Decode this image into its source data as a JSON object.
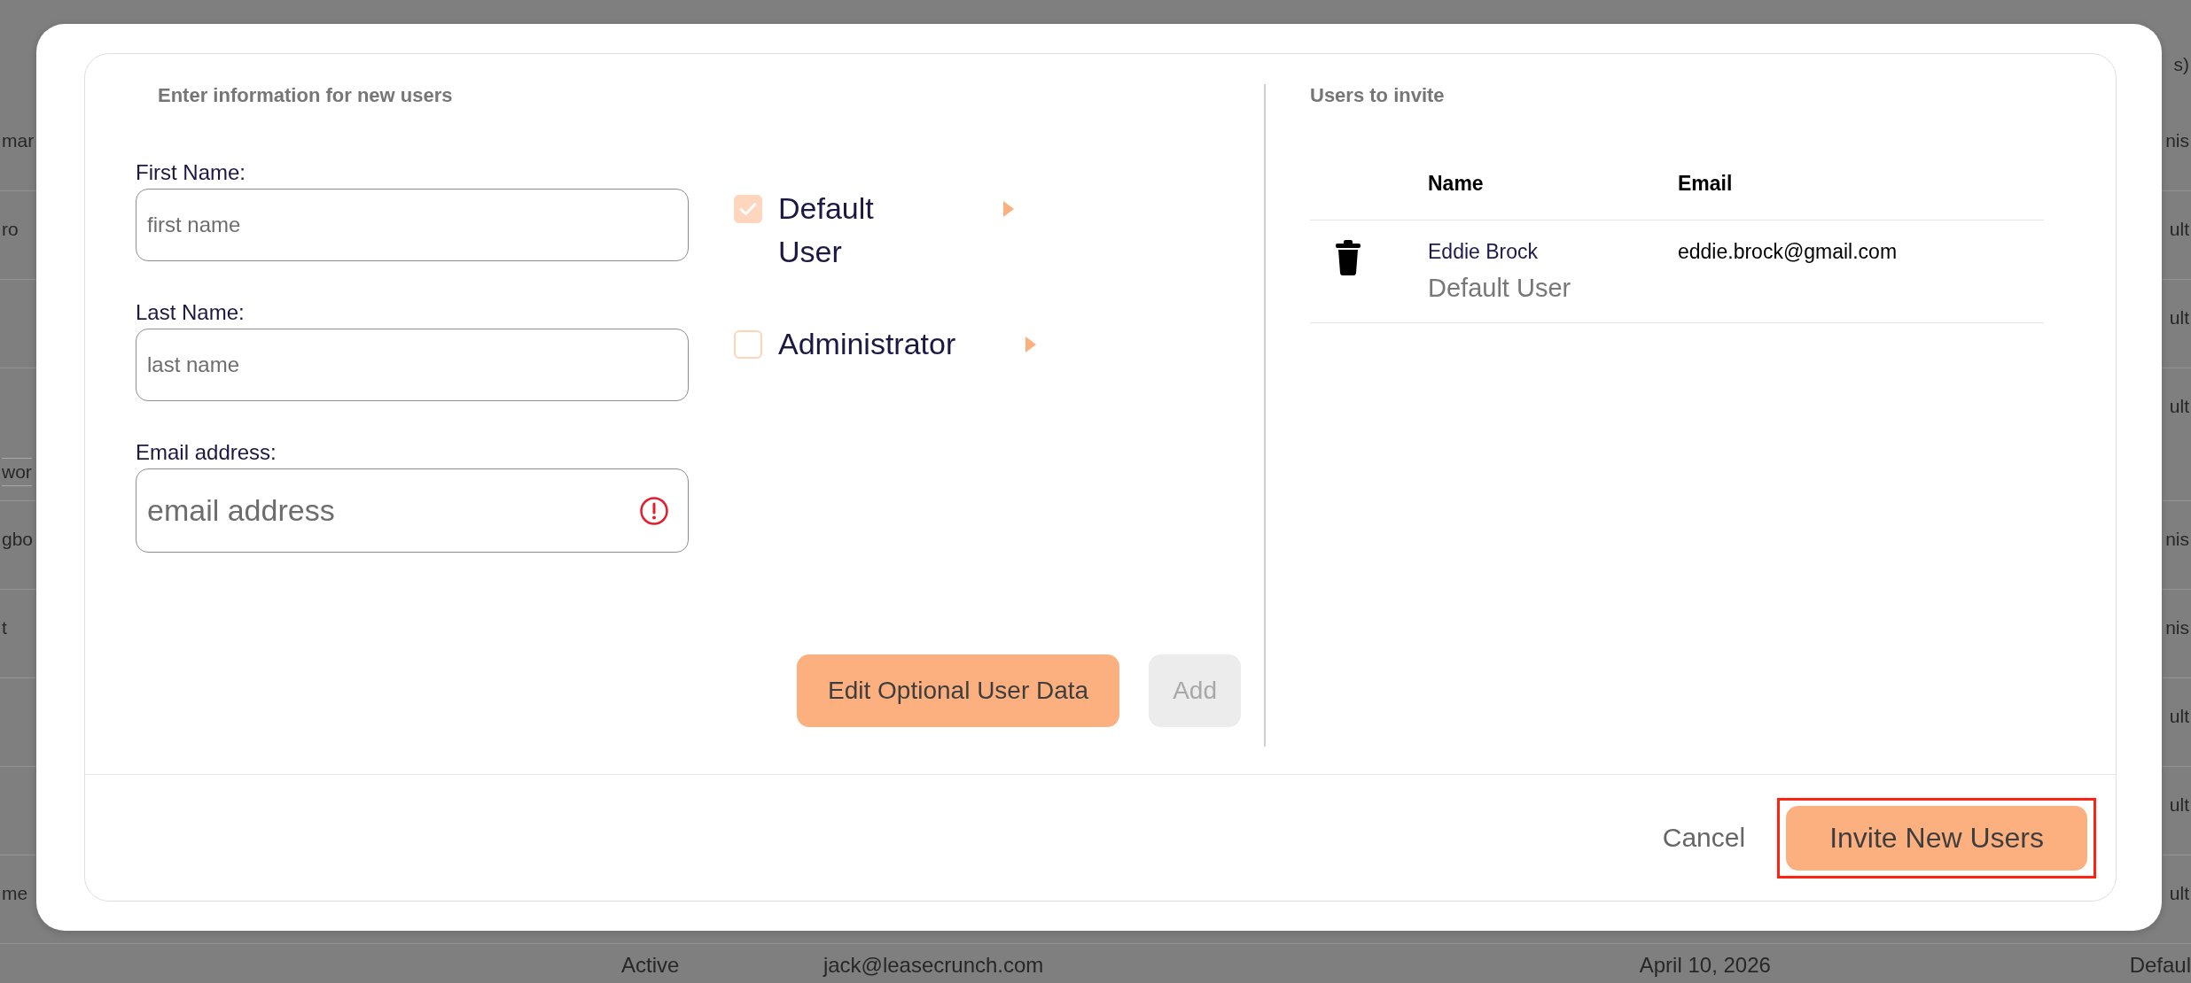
{
  "background_table": {
    "header": {
      "column_last": "s)"
    },
    "rows": [
      {
        "kind": "normal",
        "column_1": "mar",
        "column_last": "nis"
      },
      {
        "kind": "normal",
        "column_1": "ro",
        "column_last": "ult"
      },
      {
        "kind": "normal",
        "column_last": "ult"
      },
      {
        "kind": "tall",
        "column_1_tag": "wor",
        "column_last": "ult"
      },
      {
        "kind": "normal",
        "column_1": "gbo",
        "column_last": "nis"
      },
      {
        "kind": "normal",
        "column_1": "t",
        "column_last": "nis"
      },
      {
        "kind": "normal",
        "column_last": "ult"
      },
      {
        "kind": "normal",
        "column_last": "ult"
      },
      {
        "kind": "normal",
        "column_1": "me",
        "column_last": "ult"
      },
      {
        "kind": "partial",
        "status": "Active",
        "email": "jack@leasecrunch.com",
        "date": "April 10, 2026",
        "column_last": "Defaul"
      }
    ]
  },
  "dialog": {
    "new_users": {
      "heading": "Enter information for new users",
      "fields": [
        {
          "label": "First Name:",
          "placeholder": "first name",
          "kind": "small",
          "error": false
        },
        {
          "label": "Last Name:",
          "placeholder": "last name",
          "kind": "small",
          "error": false
        },
        {
          "label": "Email address:",
          "placeholder": "email address",
          "kind": "large",
          "error": true
        }
      ],
      "roles": [
        {
          "label": "Default User",
          "checked": true
        },
        {
          "label": "Administrator",
          "checked": false
        }
      ],
      "buttons": [
        {
          "label": "Edit Optional User Data",
          "disabled": false
        },
        {
          "label": "Add",
          "disabled": true
        }
      ]
    },
    "users_to_invite": {
      "heading": "Users to invite",
      "columns": [
        "Name",
        "Email"
      ],
      "rows": [
        {
          "name": "Eddie Brock",
          "role": "Default User",
          "email": "eddie.brock@gmail.com"
        }
      ]
    },
    "footer": {
      "buttons": [
        {
          "label": "Cancel",
          "kind": "link",
          "highlighted": false
        },
        {
          "label": "Invite New Users",
          "kind": "primary",
          "highlighted": true
        }
      ]
    }
  }
}
